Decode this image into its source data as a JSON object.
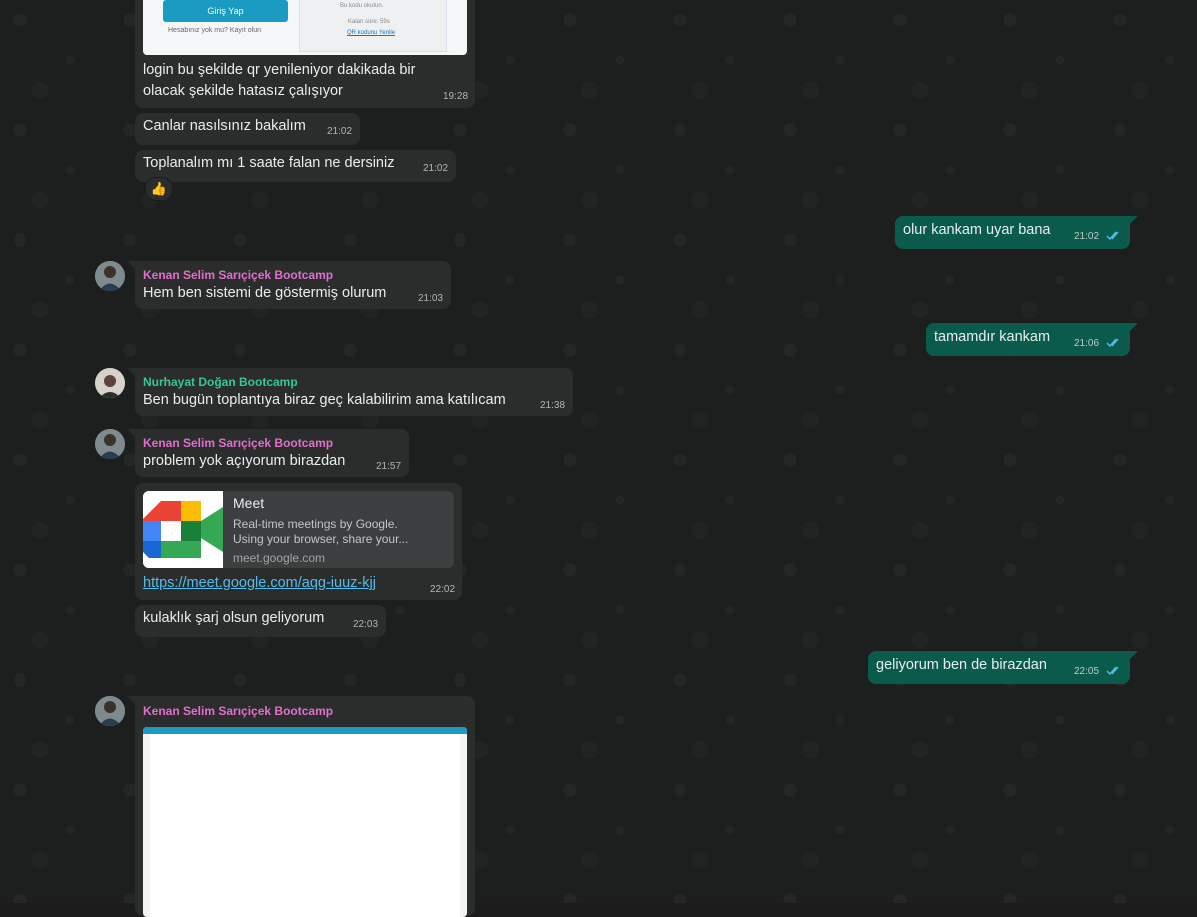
{
  "messages": {
    "m1": {
      "login_caption": "login bu şekilde qr yenileniyor dakikada bir",
      "login_caption2": "olacak şekilde hatasız çalışıyor",
      "time": "19:28",
      "screenshot": {
        "button": "Giriş Yap",
        "register": "Hesabınız yok mu? Kayıt olun",
        "qr_line1": "Bu kodu okutun.",
        "qr_line2": "Kalan süre: 59s",
        "qr_link": "QR kodunu Yenile"
      }
    },
    "m2": {
      "text": "Canlar nasılsınız bakalım",
      "time": "21:02"
    },
    "m3": {
      "text": "Toplanalım mı 1 saate falan ne dersiniz",
      "time": "21:02",
      "reaction": "👍"
    },
    "m4": {
      "text": "olur kankam uyar bana",
      "time": "21:02"
    },
    "m5": {
      "sender": "Kenan Selim Sarıçiçek Bootcamp",
      "text": "Hem ben sistemi de göstermiş olurum",
      "time": "21:03"
    },
    "m6": {
      "text": "tamamdır kankam",
      "time": "21:06"
    },
    "m7": {
      "sender": "Nurhayat Doğan Bootcamp",
      "text": "Ben bugün toplantıya biraz geç kalabilirim ama katılıcam",
      "time": "21:38"
    },
    "m8": {
      "sender": "Kenan Selim Sarıçiçek Bootcamp",
      "text": "problem yok açıyorum birazdan",
      "time": "21:57"
    },
    "m9": {
      "preview_title": "Meet",
      "preview_desc1": "Real-time meetings by Google.",
      "preview_desc2": "Using your browser, share your...",
      "preview_domain": "meet.google.com",
      "link": "https://meet.google.com/aqg-iuuz-kjj",
      "time": "22:02"
    },
    "m10": {
      "text": "kulaklık şarj olsun geliyorum",
      "time": "22:03"
    },
    "m11": {
      "text": "geliyorum ben de birazdan",
      "time": "22:05"
    },
    "m12": {
      "sender": "Kenan Selim Sarıçiçek Bootcamp"
    }
  },
  "colors": {
    "incoming": "#2b2c2c",
    "outgoing": "#0a5b4c",
    "sender_kenan": "#e06fce",
    "sender_nurhayat": "#35c98f",
    "link": "#53bdeb",
    "ticks": "#53bdeb"
  },
  "icons": {
    "read_ticks": "double-check-icon",
    "thumbs_up": "thumbs-up-emoji",
    "meet_logo": "google-meet-logo"
  }
}
